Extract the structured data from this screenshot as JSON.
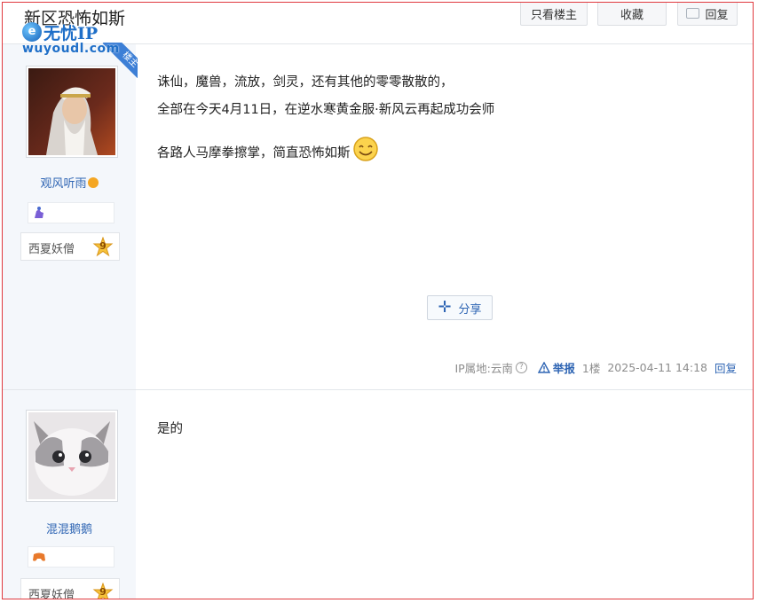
{
  "page": {
    "title": "新区恐怖如斯"
  },
  "watermark": {
    "brand": "无忧IP",
    "url": "wuyoudl.com"
  },
  "toolbar": {
    "only_owner": "只看楼主",
    "favorite": "收藏",
    "reply": "回复"
  },
  "posts": [
    {
      "username": "观风听雨",
      "owner_tag": "楼主",
      "level_name": "西夏妖僧",
      "level_num": "9",
      "lines": [
        "诛仙，魔兽，流放，剑灵，还有其他的零零散散的，",
        "全部在今天4月11日，在逆水寒黄金服·新风云再起成功会师",
        "各路人马摩拳擦掌，简直恐怖如斯"
      ],
      "share": "分享",
      "ip_location": "IP属地:云南",
      "report": "举报",
      "floor": "1楼",
      "time": "2025-04-11 14:18",
      "reply": "回复"
    },
    {
      "username": "混混鹅鹅",
      "level_name": "西夏妖僧",
      "level_num": "9",
      "text": "是的"
    }
  ],
  "colors": {
    "frame": "#e0393e",
    "link": "#2d64b3",
    "sidebar": "#f4f7fb",
    "owner_tag_bg": "#3d7fd6"
  }
}
